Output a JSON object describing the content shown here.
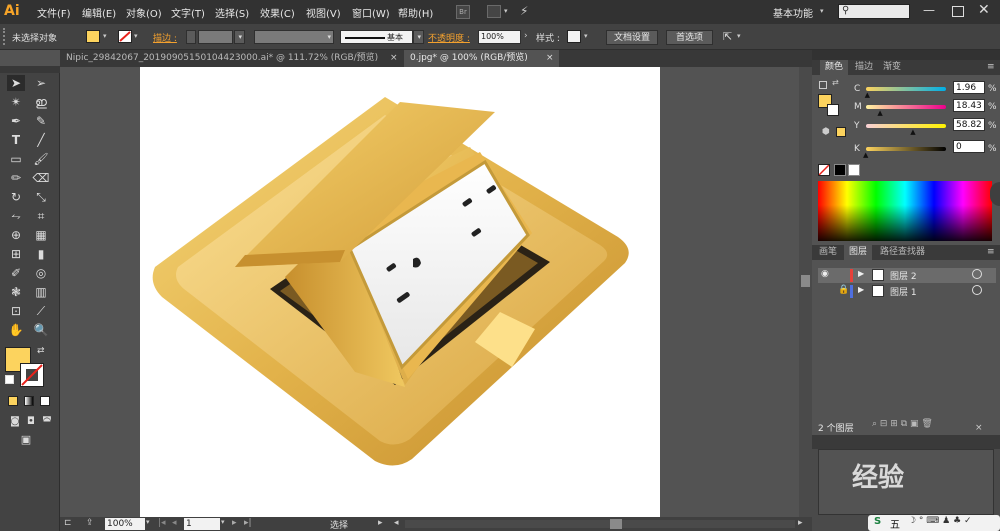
{
  "app": {
    "logo": "Ai",
    "workspace": "基本功能",
    "search_placeholder": ""
  },
  "menu": [
    "文件(F)",
    "编辑(E)",
    "对象(O)",
    "文字(T)",
    "选择(S)",
    "效果(C)",
    "视图(V)",
    "窗口(W)",
    "帮助(H)"
  ],
  "menu_extra": {
    "br": "Br"
  },
  "control": {
    "selection": "未选择对象",
    "stroke_label": "描边 :",
    "brush_label": "基本",
    "opacity_label": "不透明度 :",
    "opacity_value": "100%",
    "style_label": "样式 :",
    "doc_setup": "文档设置",
    "prefs": "首选项"
  },
  "tabs": [
    {
      "label": "Nipic_29842067_20190905150104423000.ai* @ 111.72% (RGB/预览)",
      "close": "×",
      "active": false
    },
    {
      "label": "0.jpg* @ 100% (RGB/预览)",
      "close": "×",
      "active": true
    }
  ],
  "status": {
    "zoom": "100%",
    "page": "1",
    "tool": "选择"
  },
  "color_panel": {
    "tabs": [
      "颜色",
      "描边",
      "渐变"
    ],
    "channels": [
      {
        "label": "C",
        "value": "1.96",
        "unit": "%",
        "level": 0.02
      },
      {
        "label": "M",
        "value": "18.43",
        "unit": "%",
        "level": 0.18
      },
      {
        "label": "Y",
        "value": "58.82",
        "unit": "%",
        "level": 0.59
      },
      {
        "label": "K",
        "value": "0",
        "unit": "%",
        "level": 0.0
      }
    ]
  },
  "layers_panel": {
    "tabs": [
      "画笔",
      "图层",
      "路径查找器"
    ],
    "layers": [
      {
        "name": "图层 2",
        "color": "#e8403a",
        "visible": true,
        "locked": false
      },
      {
        "name": "图层 1",
        "color": "#4f6fe0",
        "visible": false,
        "locked": true
      }
    ],
    "count": "2 个图层"
  },
  "colors": {
    "fill": "#fcd35e",
    "accent": "#f4a12e"
  },
  "watermark": "经验",
  "taskbar": {
    "ime": "五"
  }
}
